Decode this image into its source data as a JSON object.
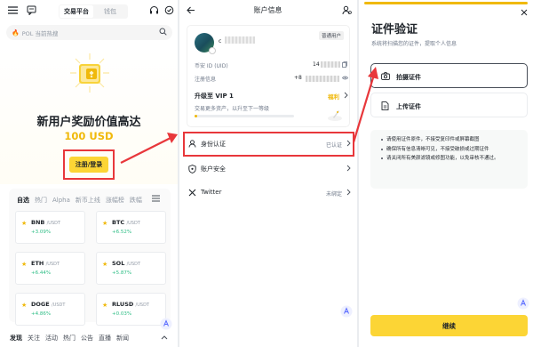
{
  "colors": {
    "brand": "#fcd535",
    "gold": "#f0b90b",
    "highlight": "#e8373b",
    "up": "#2ebd85"
  },
  "home": {
    "segment": {
      "active": "交易平台",
      "inactive": "钱包"
    },
    "search_placeholder": "POL 当前热搜",
    "hero_title": "新用户奖励价值高达",
    "hero_amount": "100 USD",
    "register_label": "注册/登录",
    "market_tabs": [
      "自选",
      "热门",
      "Alpha",
      "新币上线",
      "涨幅榜",
      "跌幅"
    ],
    "tickers": [
      {
        "symbol": "BNB",
        "quote": "/USDT",
        "change": "+3.09%"
      },
      {
        "symbol": "BTC",
        "quote": "/USDT",
        "change": "+6.52%"
      },
      {
        "symbol": "ETH",
        "quote": "/USDT",
        "change": "+6.44%"
      },
      {
        "symbol": "SOL",
        "quote": "/USDT",
        "change": "+5.87%"
      },
      {
        "symbol": "DOGE",
        "quote": "/USDT",
        "change": "+4.86%"
      },
      {
        "symbol": "RLUSD",
        "quote": "/USDT",
        "change": "+0.03%"
      }
    ],
    "bottom_nav": [
      "发现",
      "关注",
      "活动",
      "热门",
      "公告",
      "直播",
      "新闻"
    ]
  },
  "account": {
    "title": "账户信息",
    "user_initial": "c",
    "user_level_badge": "普通用户",
    "uid_label": "币安 ID (UID)",
    "uid_value": "14",
    "register_label": "注册信息",
    "register_value": "+8",
    "vip_title": "升级至 VIP 1",
    "vip_sub": "交易更多资产，以升至下一等级",
    "welfare_label": "福利",
    "vip_progress": 0.03,
    "rows": [
      {
        "label": "身份认证",
        "value": "已认证",
        "icon": "person-icon"
      },
      {
        "label": "账户安全",
        "value": "",
        "icon": "shield-icon"
      },
      {
        "label": "Twitter",
        "value": "未绑定",
        "icon": "x-logo-icon"
      }
    ]
  },
  "verify": {
    "title": "证件验证",
    "subtitle": "系统将扫描您的证件，提取个人信息",
    "option_photo": "拍摄证件",
    "option_upload": "上传证件",
    "tips": [
      "请使用证件原件，不接受复印件或屏幕截图",
      "确保所有信息清晰可见，不接受破损或过期证件",
      "请关闭所有美颜滤镜或修图功能，以免审核不通过。"
    ],
    "continue_label": "继续"
  }
}
